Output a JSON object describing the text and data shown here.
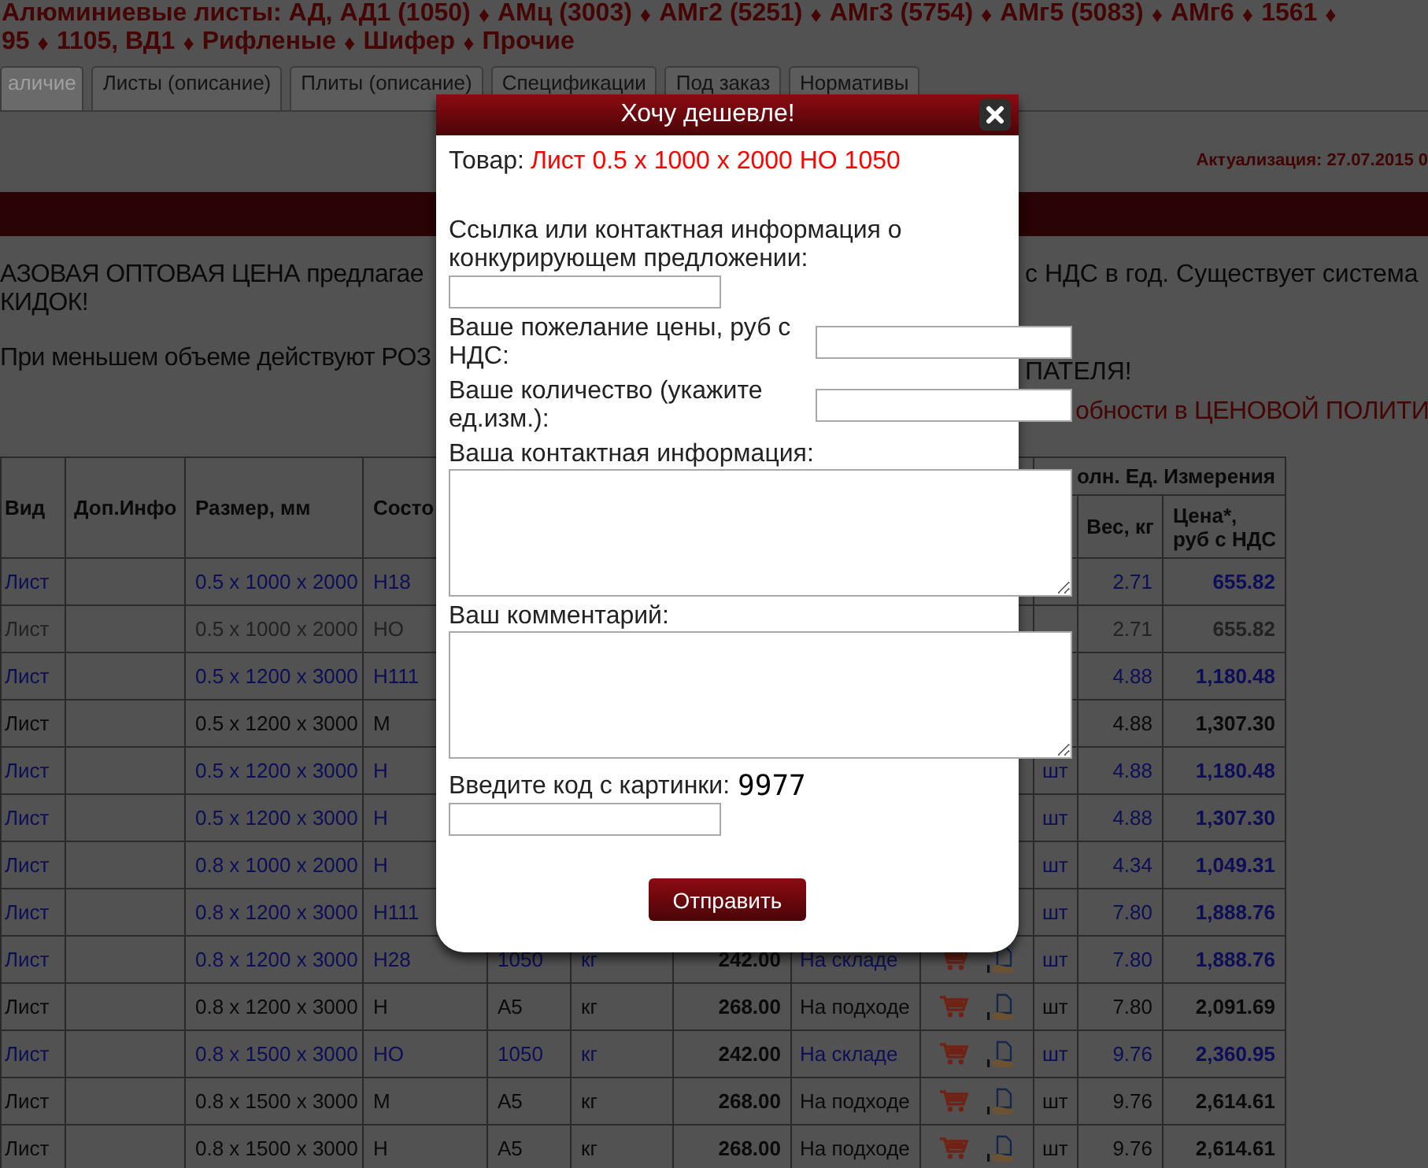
{
  "top_links": [
    [
      {
        "kind": "link",
        "text": "Алюминиевые листы: АД, АД1 (1050)"
      },
      {
        "kind": "separator",
        "text": "♦"
      },
      {
        "kind": "link",
        "text": "АМц (3003)"
      },
      {
        "kind": "separator",
        "text": "♦"
      },
      {
        "kind": "link",
        "text": "АМг2 (5251)"
      },
      {
        "kind": "separator",
        "text": "♦"
      },
      {
        "kind": "link",
        "text": "АМг3 (5754)"
      },
      {
        "kind": "separator",
        "text": "♦"
      },
      {
        "kind": "link",
        "text": "АМг5 (5083)"
      },
      {
        "kind": "separator",
        "text": "♦"
      },
      {
        "kind": "link",
        "text": "АМг6"
      },
      {
        "kind": "separator",
        "text": "♦"
      },
      {
        "kind": "link",
        "text": "1561"
      },
      {
        "kind": "separator",
        "text": "♦"
      }
    ],
    [
      {
        "kind": "link",
        "text": "95"
      },
      {
        "kind": "separator",
        "text": "♦"
      },
      {
        "kind": "link",
        "text": "1105, ВД1"
      },
      {
        "kind": "separator",
        "text": "♦"
      },
      {
        "kind": "link",
        "text": "Рифленые"
      },
      {
        "kind": "separator",
        "text": "♦"
      },
      {
        "kind": "link",
        "text": "Шифер"
      },
      {
        "kind": "separator",
        "text": "♦"
      },
      {
        "kind": "link",
        "text": "Прочие"
      }
    ]
  ],
  "tabs": [
    {
      "label": "аличие",
      "selected": true
    },
    {
      "label": "Листы (описание)",
      "selected": false
    },
    {
      "label": "Плиты (описание)",
      "selected": false
    },
    {
      "label": "Спецификации",
      "selected": false
    },
    {
      "label": "Под заказ",
      "selected": false
    },
    {
      "label": "Нормативы",
      "selected": false
    }
  ],
  "update_note": "Актуализация: 27.07.2015 0",
  "notice": {
    "line_1": {
      "left": "АЗОВАЯ ОПТОВАЯ ЦЕНА предлагае",
      "right": "с НДС в год. Существует система"
    },
    "line_2": "КИДОК!",
    "line_3": {
      "left": "При меньшем объеме действуют РОЗ",
      "right": "ПАТЕЛЯ!"
    },
    "policy_link": "обности в ЦЕНОВОЙ ПОЛИТИ"
  },
  "table": {
    "columns": [
      "Вид",
      "Доп.Инфо",
      "Размер, мм",
      "Состо"
    ],
    "group_header": "олн. Ед. Измерения",
    "group_columns": [
      "Вес, кг",
      "Цена*,\nруб с НДС"
    ],
    "rows": [
      {
        "kind": "in_stock",
        "type": "Лист",
        "size": "0.5 x 1000 x 2000",
        "temper": "Н18",
        "weight": "2.71",
        "price": "655.82"
      },
      {
        "kind": "inactive",
        "type": "Лист",
        "size": "0.5 x 1000 x 2000",
        "temper": "НО",
        "weight": "2.71",
        "price": "655.82"
      },
      {
        "kind": "in_stock",
        "type": "Лист",
        "size": "0.5 x 1200 x 3000",
        "temper": "Н111",
        "weight": "4.88",
        "price": "1,180.48"
      },
      {
        "kind": "incoming",
        "type": "Лист",
        "size": "0.5 x 1200 x 3000",
        "temper": "М",
        "weight": "4.88",
        "price": "1,307.30"
      },
      {
        "kind": "in_stock",
        "type": "Лист",
        "size": "0.5 x 1200 x 3000",
        "temper": "Н",
        "alt_unit": "шт",
        "weight": "4.88",
        "price": "1,180.48"
      },
      {
        "kind": "in_stock",
        "type": "Лист",
        "size": "0.5 x 1200 x 3000",
        "temper": "Н",
        "alt_unit": "шт",
        "weight": "4.88",
        "price": "1,307.30"
      },
      {
        "kind": "in_stock",
        "type": "Лист",
        "size": "0.8 x 1000 x 2000",
        "temper": "Н",
        "alt_unit": "шт",
        "weight": "4.34",
        "price": "1,049.31"
      },
      {
        "kind": "in_stock",
        "type": "Лист",
        "size": "0.8 x 1200 x 3000",
        "temper": "Н111",
        "alt_unit": "шт",
        "weight": "7.80",
        "price": "1,888.76"
      },
      {
        "kind": "in_stock",
        "type": "Лист",
        "size": "0.8 x 1200 x 3000",
        "temper": "Н28",
        "alloy": "1050",
        "unit": "кг",
        "base_price": "242.00",
        "availability": "На складе",
        "actions": true,
        "alt_unit": "шт",
        "weight": "7.80",
        "price": "1,888.76"
      },
      {
        "kind": "incoming",
        "type": "Лист",
        "size": "0.8 x 1200 x 3000",
        "temper": "Н",
        "alloy": "А5",
        "unit": "кг",
        "base_price": "268.00",
        "availability": "На подходе",
        "actions": true,
        "alt_unit": "шт",
        "weight": "7.80",
        "price": "2,091.69"
      },
      {
        "kind": "in_stock",
        "type": "Лист",
        "size": "0.8 x 1500 x 3000",
        "temper": "НО",
        "alloy": "1050",
        "unit": "кг",
        "base_price": "242.00",
        "availability": "На складе",
        "actions": true,
        "alt_unit": "шт",
        "weight": "9.76",
        "price": "2,360.95"
      },
      {
        "kind": "incoming",
        "type": "Лист",
        "size": "0.8 x 1500 x 3000",
        "temper": "М",
        "alloy": "А5",
        "unit": "кг",
        "base_price": "268.00",
        "availability": "На подходе",
        "actions": true,
        "alt_unit": "шт",
        "weight": "9.76",
        "price": "2,614.61"
      },
      {
        "kind": "incoming",
        "type": "Лист",
        "size": "0.8 x 1500 x 3000",
        "temper": "Н",
        "alloy": "А5",
        "unit": "кг",
        "base_price": "268.00",
        "availability": "На подходе",
        "actions": true,
        "alt_unit": "шт",
        "weight": "9.76",
        "price": "2,614.61"
      }
    ]
  },
  "dialog": {
    "title": "Хочу дешевле!",
    "product_label": "Товар:",
    "product": "Лист 0.5 x 1000 x 2000 НО 1050",
    "fields": [
      {
        "kind": "stacked",
        "label": "Ссылка или контактная информация о конкурирующем предложении:"
      },
      {
        "kind": "inline",
        "label": "Ваше пожелание цены, руб с НДС:"
      },
      {
        "kind": "inline",
        "label": "Ваше количество (укажите ед.изм.):"
      },
      {
        "kind": "textarea",
        "label": "Ваша контактная информация:"
      },
      {
        "kind": "textarea",
        "label": "Ваш комментарий:"
      },
      {
        "kind": "captcha",
        "label": "Введите код с картинки:",
        "code": "9977"
      }
    ],
    "submit": "Отправить"
  }
}
